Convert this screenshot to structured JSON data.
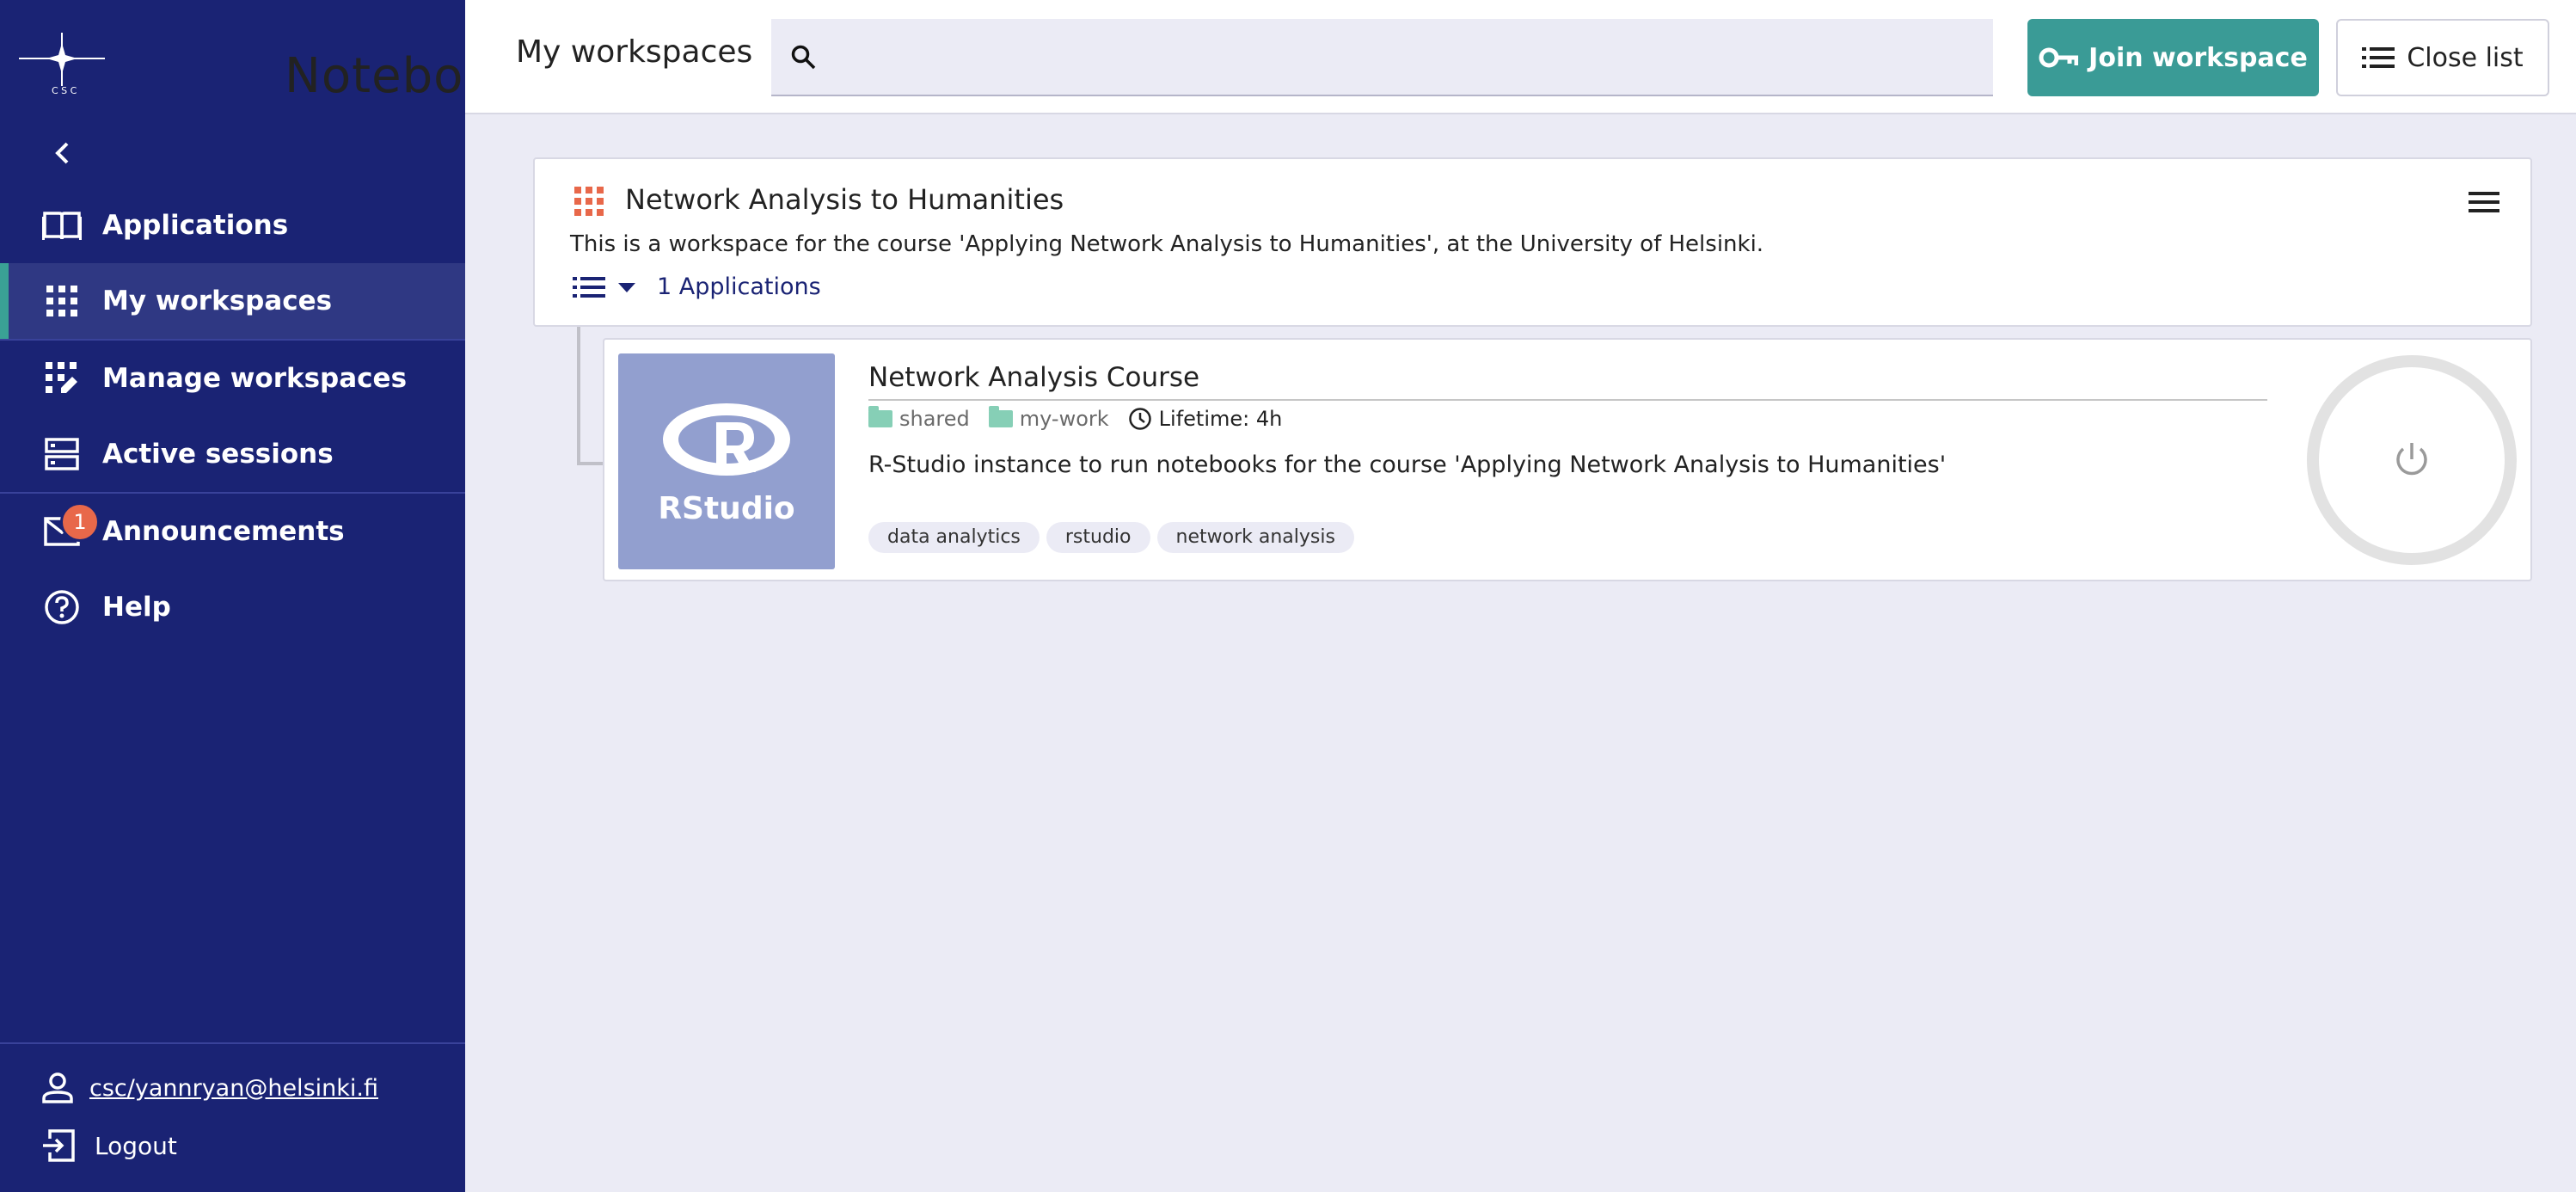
{
  "sidebar": {
    "brand_name": "Notebooks",
    "logo_text": "CSC",
    "items": [
      {
        "label": "Applications",
        "icon": "book-icon"
      },
      {
        "label": "My workspaces",
        "icon": "grid-icon",
        "active": true
      },
      {
        "label": "Manage workspaces",
        "icon": "manage-grid-icon"
      },
      {
        "label": "Active sessions",
        "icon": "server-icon"
      },
      {
        "label": "Announcements",
        "icon": "mail-icon",
        "badge": "1"
      },
      {
        "label": "Help",
        "icon": "help-icon"
      }
    ],
    "user": "csc/yannryan@helsinki.fi",
    "logout_label": "Logout"
  },
  "header": {
    "title": "My workspaces",
    "search_placeholder": "",
    "join_label": "Join workspace",
    "close_label": "Close list"
  },
  "workspace": {
    "title": "Network Analysis to Humanities",
    "description": "This is a workspace for the course 'Applying Network Analysis to Humanities', at the University of Helsinki.",
    "apps_label": "1 Applications"
  },
  "application": {
    "thumb_label": "RStudio",
    "name": "Network Analysis Course",
    "meta": [
      "shared",
      "my-work"
    ],
    "lifetime": "Lifetime: 4h",
    "description": "R-Studio instance to run notebooks for the course 'Applying Network Analysis to Humanities'",
    "tags": [
      "data analytics",
      "rstudio",
      "network analysis"
    ]
  },
  "colors": {
    "sidebar_bg": "#1a2374",
    "active_accent": "#3aa195",
    "primary_button": "#3a9b96",
    "badge": "#e8684a",
    "thumb_bg": "#929fcf",
    "folder": "#86cfb6"
  }
}
